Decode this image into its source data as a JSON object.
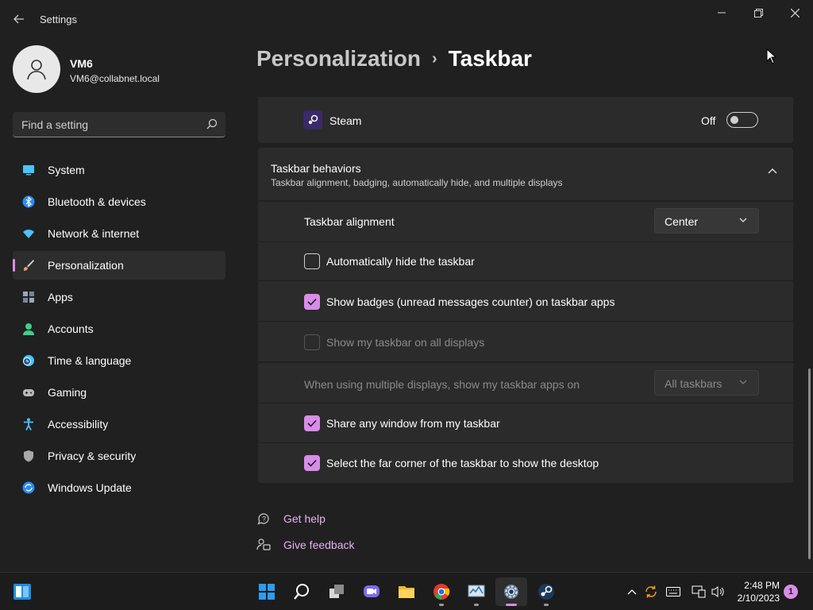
{
  "window": {
    "title": "Settings"
  },
  "profile": {
    "name": "VM6",
    "email": "VM6@collabnet.local"
  },
  "search": {
    "placeholder": "Find a setting"
  },
  "sidebar": {
    "items": [
      {
        "label": "System",
        "icon": "system-icon",
        "color": "#4cc2ff",
        "active": false
      },
      {
        "label": "Bluetooth & devices",
        "icon": "bluetooth-icon",
        "color": "#2b8cf0",
        "active": false
      },
      {
        "label": "Network & internet",
        "icon": "wifi-icon",
        "color": "#4cc2ff",
        "active": false
      },
      {
        "label": "Personalization",
        "icon": "brush-icon",
        "color": "#f0a050",
        "active": true
      },
      {
        "label": "Apps",
        "icon": "apps-icon",
        "color": "#9aa6b8",
        "active": false
      },
      {
        "label": "Accounts",
        "icon": "person-icon",
        "color": "#3fcf8e",
        "active": false
      },
      {
        "label": "Time & language",
        "icon": "clock-globe-icon",
        "color": "#4cc2ff",
        "active": false
      },
      {
        "label": "Gaming",
        "icon": "gamepad-icon",
        "color": "#b8b8b8",
        "active": false
      },
      {
        "label": "Accessibility",
        "icon": "accessibility-icon",
        "color": "#4cc2ff",
        "active": false
      },
      {
        "label": "Privacy & security",
        "icon": "shield-icon",
        "color": "#a8a8a8",
        "active": false
      },
      {
        "label": "Windows Update",
        "icon": "update-icon",
        "color": "#2b8cf0",
        "active": false
      }
    ]
  },
  "breadcrumb": {
    "parent": "Personalization",
    "separator": "›",
    "current": "Taskbar"
  },
  "steam_row": {
    "label": "Steam",
    "toggle_state": "Off"
  },
  "behaviors": {
    "title": "Taskbar behaviors",
    "subtitle": "Taskbar alignment, badging, automatically hide, and multiple displays",
    "alignment_label": "Taskbar alignment",
    "alignment_value": "Center",
    "autohide_label": "Automatically hide the taskbar",
    "autohide_checked": false,
    "badges_label": "Show badges (unread messages counter) on taskbar apps",
    "badges_checked": true,
    "all_displays_label": "Show my taskbar on all displays",
    "all_displays_checked": false,
    "multi_display_label": "When using multiple displays, show my taskbar apps on",
    "multi_display_value": "All taskbars",
    "share_label": "Share any window from my taskbar",
    "share_checked": true,
    "far_corner_label": "Select the far corner of the taskbar to show the desktop",
    "far_corner_checked": true
  },
  "help": {
    "get_help": "Get help",
    "give_feedback": "Give feedback"
  },
  "taskbar": {
    "apps": [
      {
        "name": "start",
        "icon": "windows-logo-icon",
        "active": false,
        "running": false
      },
      {
        "name": "search",
        "icon": "search-icon",
        "active": false,
        "running": false
      },
      {
        "name": "task-view",
        "icon": "task-view-icon",
        "active": false,
        "running": false
      },
      {
        "name": "chat",
        "icon": "chat-icon",
        "active": false,
        "running": false
      },
      {
        "name": "file-explorer",
        "icon": "folder-icon",
        "active": false,
        "running": false
      },
      {
        "name": "chrome",
        "icon": "chrome-icon",
        "active": false,
        "running": true
      },
      {
        "name": "resource-monitor",
        "icon": "monitor-icon",
        "active": false,
        "running": true
      },
      {
        "name": "settings",
        "icon": "gear-icon",
        "active": true,
        "running": true
      },
      {
        "name": "steam",
        "icon": "steam-icon",
        "active": false,
        "running": true
      }
    ],
    "time": "2:48 PM",
    "date": "2/10/2023",
    "notifications": "1"
  },
  "colors": {
    "accent": "#d98ce8",
    "background": "#202020",
    "card": "#2b2b2b"
  }
}
